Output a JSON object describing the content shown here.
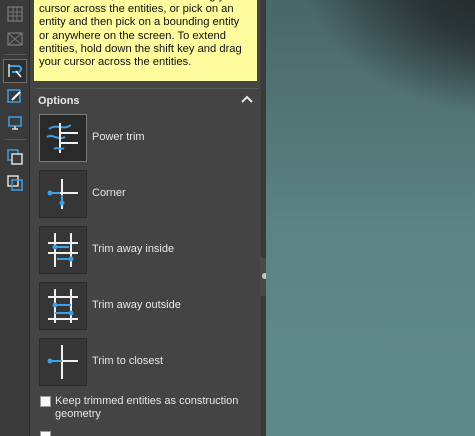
{
  "tooltip": {
    "text": "To trim entities, hold down and drag your cursor across the entities, or pick on an entity and then pick on a bounding entity or anywhere on the screen.  To extend entities, hold down the shift key and drag your cursor across the entities."
  },
  "options": {
    "title": "Options",
    "items": [
      {
        "label": "Power trim",
        "icon": "power-trim-icon",
        "selected": true
      },
      {
        "label": "Corner",
        "icon": "corner-icon",
        "selected": false
      },
      {
        "label": "Trim away inside",
        "icon": "trim-away-inside-icon",
        "selected": false
      },
      {
        "label": "Trim away outside",
        "icon": "trim-away-outside-icon",
        "selected": false
      },
      {
        "label": "Trim to closest",
        "icon": "trim-to-closest-icon",
        "selected": false
      }
    ],
    "checkboxes": [
      {
        "label": "Keep trimmed entities as construction geometry",
        "checked": false
      }
    ]
  },
  "colors": {
    "tooltip_bg": "#fffd9e",
    "panel_bg": "#444444",
    "accent_blue": "#3aa0e8",
    "viewport_teal": "#5d8485"
  }
}
